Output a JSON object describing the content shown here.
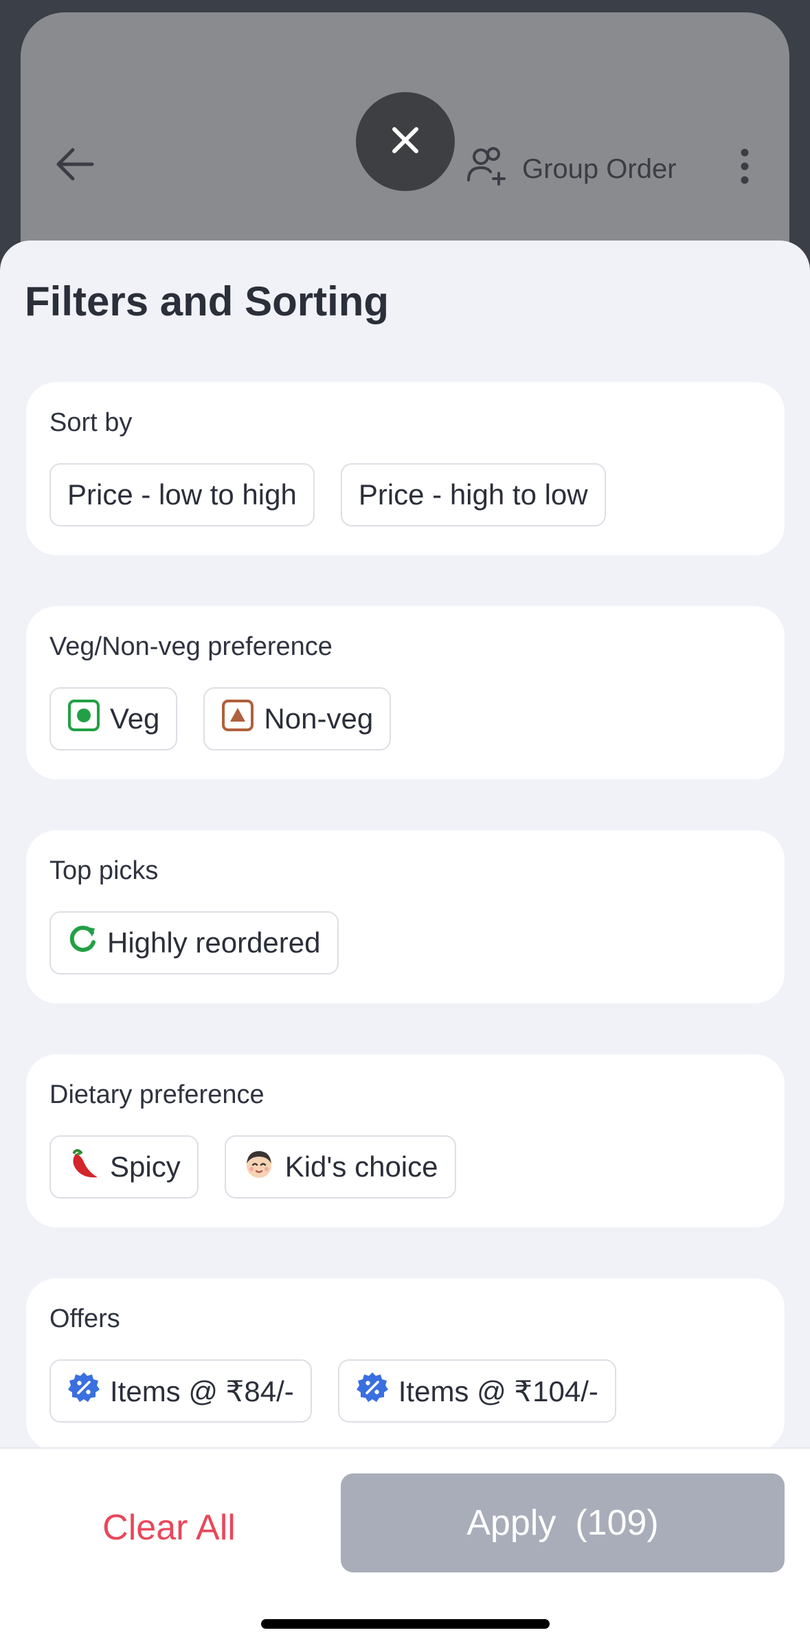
{
  "background": {
    "group_order_label": "Group Order"
  },
  "sheet": {
    "title": "Filters and Sorting",
    "sections": [
      {
        "title": "Sort by",
        "options": [
          {
            "label": "Price - low to high",
            "icon": null
          },
          {
            "label": "Price - high to low",
            "icon": null
          }
        ]
      },
      {
        "title": "Veg/Non-veg preference",
        "options": [
          {
            "label": "Veg",
            "icon": "veg-icon"
          },
          {
            "label": "Non-veg",
            "icon": "non-veg-icon"
          }
        ]
      },
      {
        "title": "Top picks",
        "options": [
          {
            "label": "Highly reordered",
            "icon": "reorder-icon"
          }
        ]
      },
      {
        "title": "Dietary preference",
        "options": [
          {
            "label": "Spicy",
            "icon": "chili-icon"
          },
          {
            "label": "Kid's choice",
            "icon": "kid-face-icon"
          }
        ]
      },
      {
        "title": "Offers",
        "options": [
          {
            "label": "Items @ ₹84/-",
            "icon": "offer-badge-icon"
          },
          {
            "label": "Items @ ₹104/-",
            "icon": "offer-badge-icon"
          }
        ]
      }
    ]
  },
  "footer": {
    "clear_label": "Clear All",
    "apply_label": "Apply",
    "apply_count": "(109)"
  },
  "colors": {
    "accent_red": "#e9475a",
    "veg_green": "#22a045",
    "nonveg_brown": "#b0603c",
    "offer_blue": "#3a6fe0",
    "apply_disabled": "#a8adb9"
  }
}
